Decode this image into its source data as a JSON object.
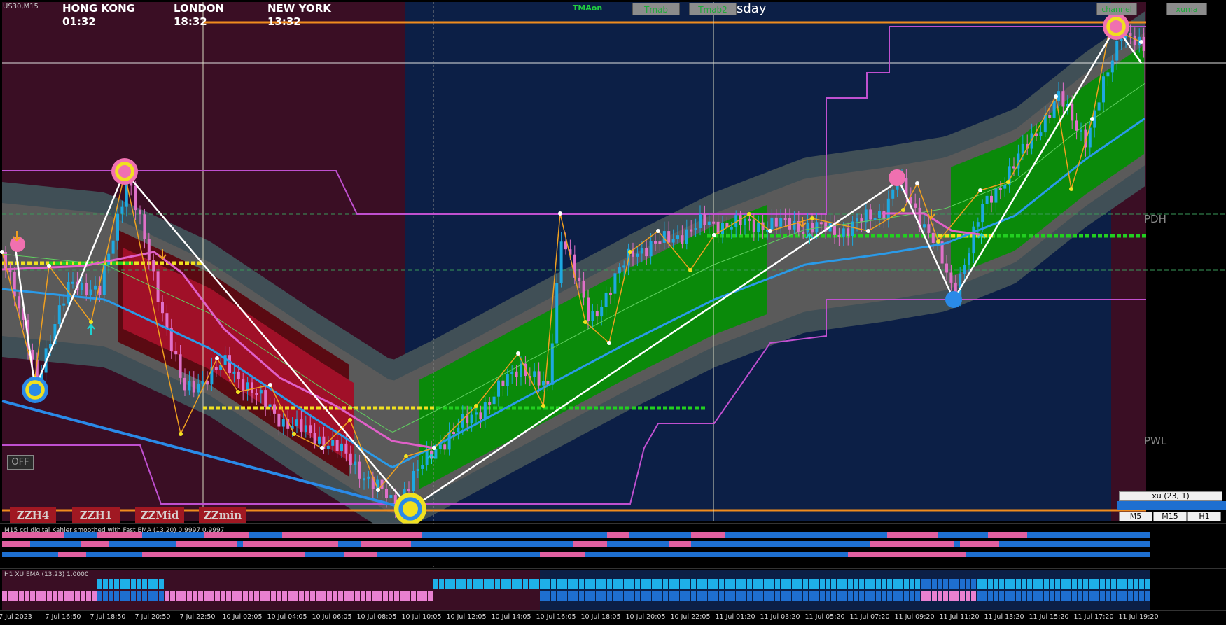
{
  "symbol": "US30,M15",
  "sessions": [
    {
      "label": "HONG KONG 01:32",
      "color": "#9c1c24"
    },
    {
      "label": "LONDON  18:32",
      "color": "#9c1c24"
    },
    {
      "label": "NEW YORK 13:32",
      "color": "#1e6fd0"
    }
  ],
  "toolbar": {
    "tma_label": "TMAon",
    "tmab_label": "Tmab",
    "tmab2_label": "Tmab2",
    "day_label": "sday",
    "channel_label": "channel",
    "xuma_label": "xuma",
    "off_label": "OFF"
  },
  "zigzag_buttons": [
    "ZZH4",
    "ZZH1",
    "ZZMid",
    "ZZmin"
  ],
  "levels": {
    "pdh_label": "PDH",
    "pwl_label": "PWL"
  },
  "xu_panel": {
    "title": "xu (23, 1)",
    "timeframes": [
      "M5",
      "M15",
      "H1"
    ]
  },
  "subwindow1": {
    "title": "M15 cci digital Kahler smoothed with Fast EMA (13,20) 0.9997 0.9997"
  },
  "subwindow2": {
    "title": "H1 XU EMA (13,23) 1.0000"
  },
  "time_axis": [
    "7 Jul 2023",
    "7 Jul 16:50",
    "7 Jul 18:50",
    "7 Jul 20:50",
    "7 Jul 22:50",
    "10 Jul 02:05",
    "10 Jul 04:05",
    "10 Jul 06:05",
    "10 Jul 08:05",
    "10 Jul 10:05",
    "10 Jul 12:05",
    "10 Jul 14:05",
    "10 Jul 16:05",
    "10 Jul 18:05",
    "10 Jul 20:05",
    "10 Jul 22:05",
    "11 Jul 01:20",
    "11 Jul 03:20",
    "11 Jul 05:20",
    "11 Jul 07:20",
    "11 Jul 09:20",
    "11 Jul 11:20",
    "11 Jul 13:20",
    "11 Jul 15:20",
    "11 Jul 17:20",
    "11 Jul 19:20"
  ],
  "colors": {
    "bull": "#1ea8e0",
    "bear": "#e070c8",
    "up_channel": "#0a8a0a",
    "down_channel": "#a01028",
    "night_bg": "#3a0e24",
    "day_bg": "#0c1f46",
    "orange": "#f08c1e",
    "magenta": "#c050d0"
  }
}
